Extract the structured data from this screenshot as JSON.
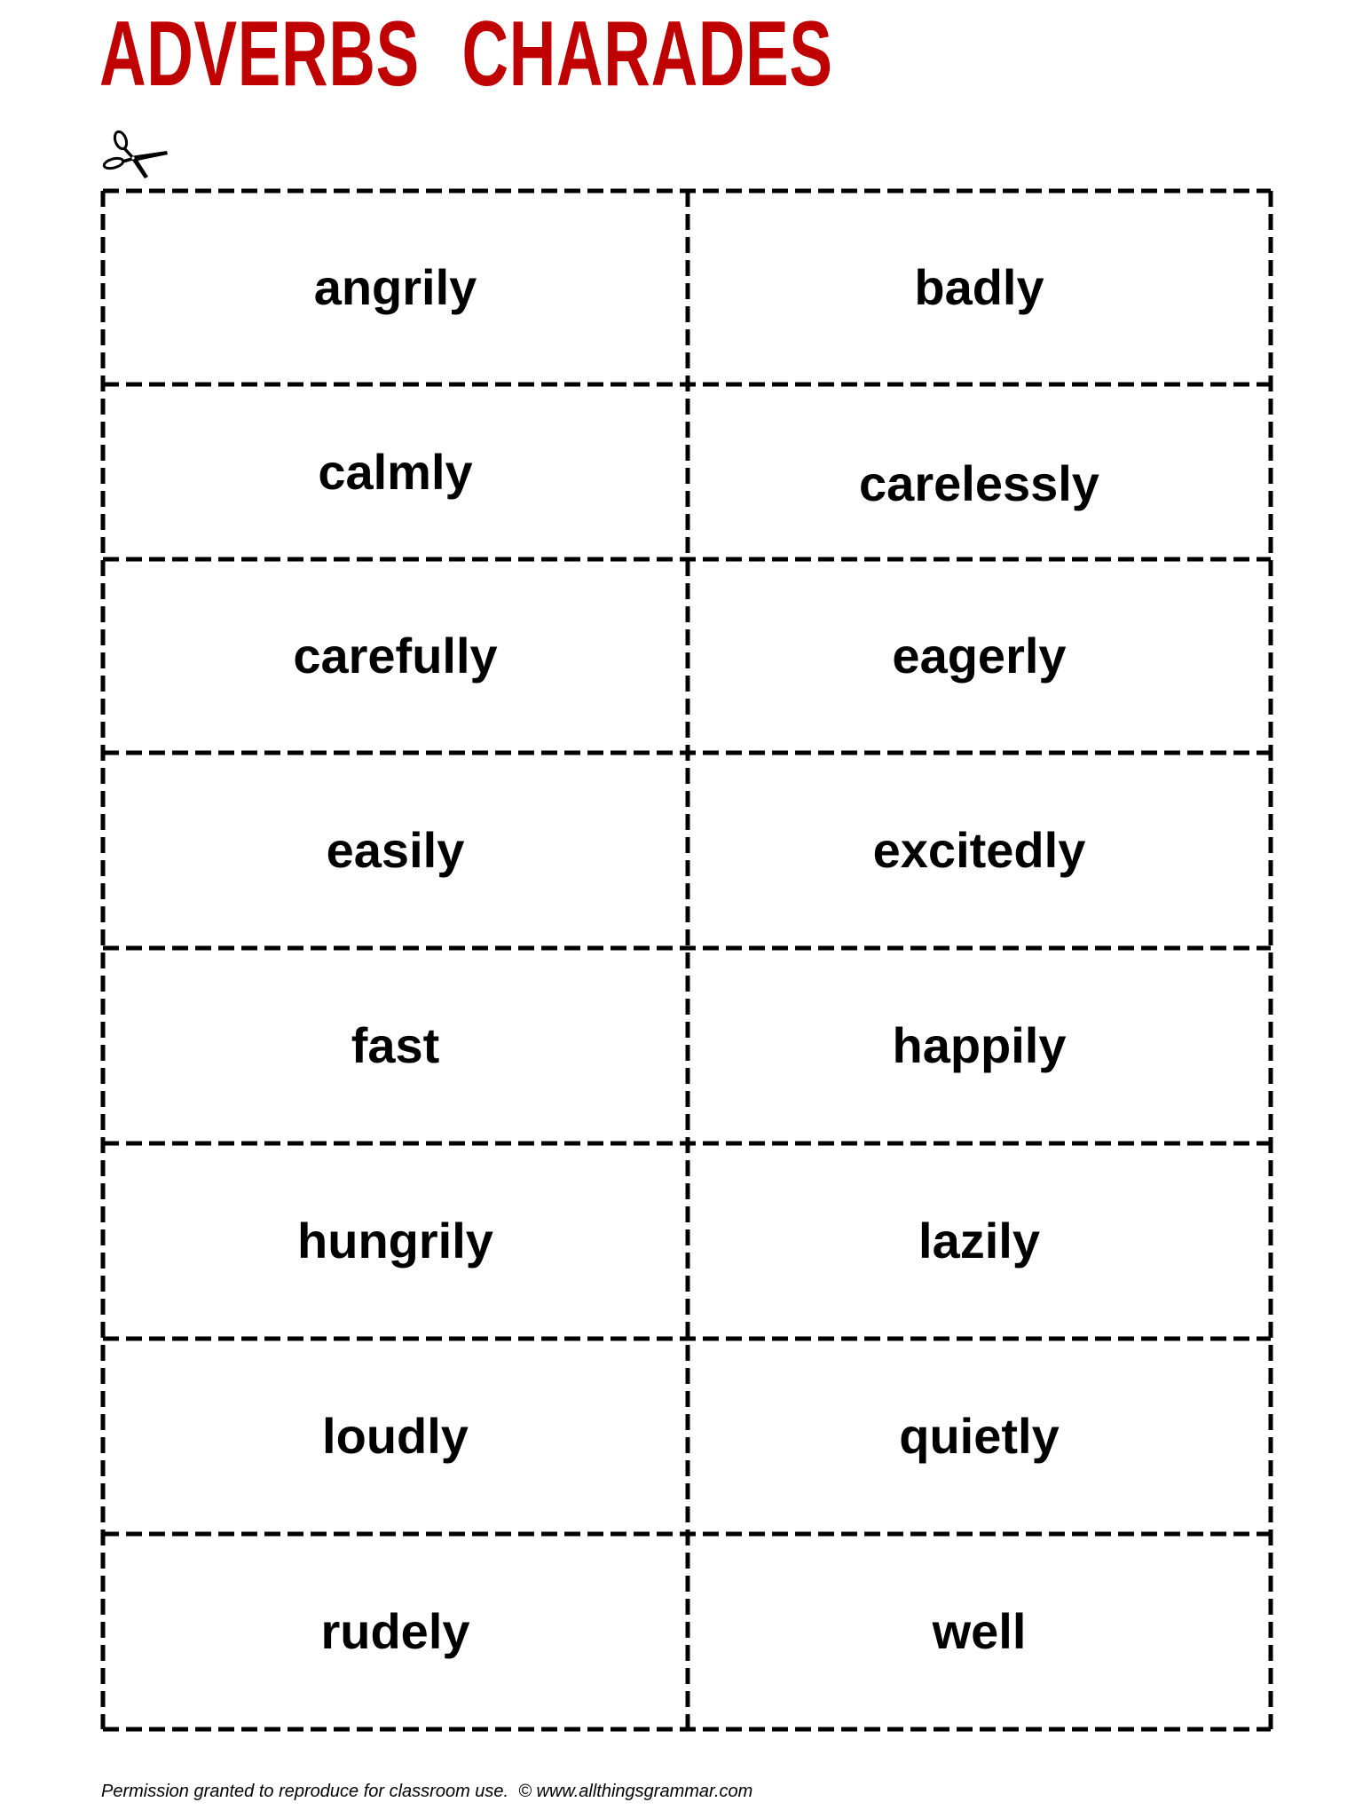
{
  "title": {
    "word1": "ADVERBS",
    "word2": "CHARADES",
    "color": "#C00000"
  },
  "cut_icon": "scissors-icon",
  "cards": [
    {
      "left": "angrily",
      "right": "badly"
    },
    {
      "left": "calmly",
      "right": "carelessly"
    },
    {
      "left": "carefully",
      "right": "eagerly"
    },
    {
      "left": "easily",
      "right": "excitedly"
    },
    {
      "left": "fast",
      "right": "happily"
    },
    {
      "left": "hungrily",
      "right": "lazily"
    },
    {
      "left": "loudly",
      "right": "quietly"
    },
    {
      "left": "rudely",
      "right": "well"
    }
  ],
  "footer": {
    "text": "Permission granted to reproduce for classroom use.  © www.allthingsgrammar.com"
  }
}
